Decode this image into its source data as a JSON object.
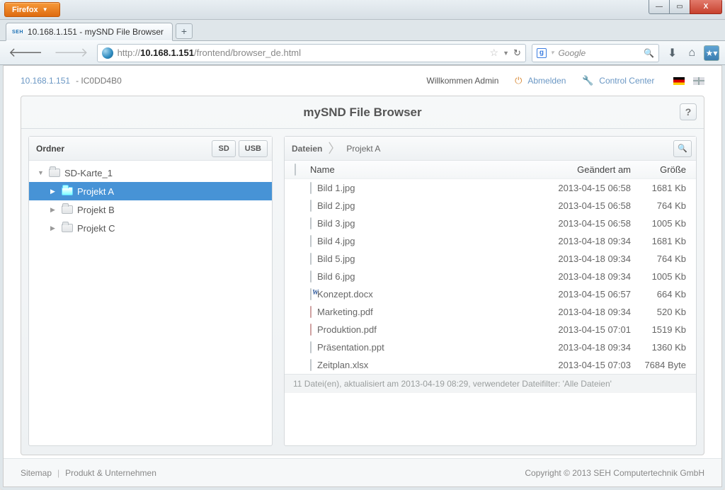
{
  "browser": {
    "menu_label": "Firefox",
    "tab_title": "10.168.1.151 - mySND File Browser",
    "new_tab_glyph": "+",
    "url_prefix": "http://",
    "url_host": "10.168.1.151",
    "url_path": "/frontend/browser_de.html",
    "search_engine": "Google"
  },
  "header": {
    "host": "10.168.1.151",
    "device_id": "IC0DD4B0",
    "welcome": "Willkommen Admin",
    "logout": "Abmelden",
    "control_center": "Control Center"
  },
  "shell": {
    "title": "mySND File Browser",
    "help_glyph": "?"
  },
  "folders_panel": {
    "title": "Ordner",
    "sd_label": "SD",
    "usb_label": "USB",
    "tree": {
      "root": "SD-Karte_1",
      "items": [
        "Projekt A",
        "Projekt B",
        "Projekt C"
      ],
      "selected_index": 0
    }
  },
  "files_panel": {
    "title": "Dateien",
    "breadcrumb_current": "Projekt A",
    "columns": {
      "name": "Name",
      "date": "Geändert am",
      "size": "Größe"
    },
    "rows": [
      {
        "icon": "img",
        "name": "Bild 1.jpg",
        "date": "2013-04-15 06:58",
        "size": "1681 Kb"
      },
      {
        "icon": "img",
        "name": "Bild 2.jpg",
        "date": "2013-04-15 06:58",
        "size": "764 Kb"
      },
      {
        "icon": "img",
        "name": "Bild 3.jpg",
        "date": "2013-04-15 06:58",
        "size": "1005 Kb"
      },
      {
        "icon": "img",
        "name": "Bild 4.jpg",
        "date": "2013-04-18 09:34",
        "size": "1681 Kb"
      },
      {
        "icon": "img",
        "name": "Bild 5.jpg",
        "date": "2013-04-18 09:34",
        "size": "764 Kb"
      },
      {
        "icon": "img",
        "name": "Bild 6.jpg",
        "date": "2013-04-18 09:34",
        "size": "1005 Kb"
      },
      {
        "icon": "docx",
        "name": "Konzept.docx",
        "date": "2013-04-15 06:57",
        "size": "664 Kb"
      },
      {
        "icon": "pdf",
        "name": "Marketing.pdf",
        "date": "2013-04-18 09:34",
        "size": "520 Kb"
      },
      {
        "icon": "pdf",
        "name": "Produktion.pdf",
        "date": "2013-04-15 07:01",
        "size": "1519 Kb"
      },
      {
        "icon": "blank",
        "name": "Präsentation.ppt",
        "date": "2013-04-18 09:34",
        "size": "1360 Kb"
      },
      {
        "icon": "blank",
        "name": "Zeitplan.xlsx",
        "date": "2013-04-15 07:03",
        "size": "7684 Byte"
      }
    ],
    "status": "11 Datei(en), aktualisiert am 2013-04-19 08:29, verwendeter Dateifilter: 'Alle Dateien'"
  },
  "footer": {
    "sitemap": "Sitemap",
    "company": "Produkt & Unternehmen",
    "copyright": "Copyright © 2013 SEH Computertechnik GmbH"
  }
}
